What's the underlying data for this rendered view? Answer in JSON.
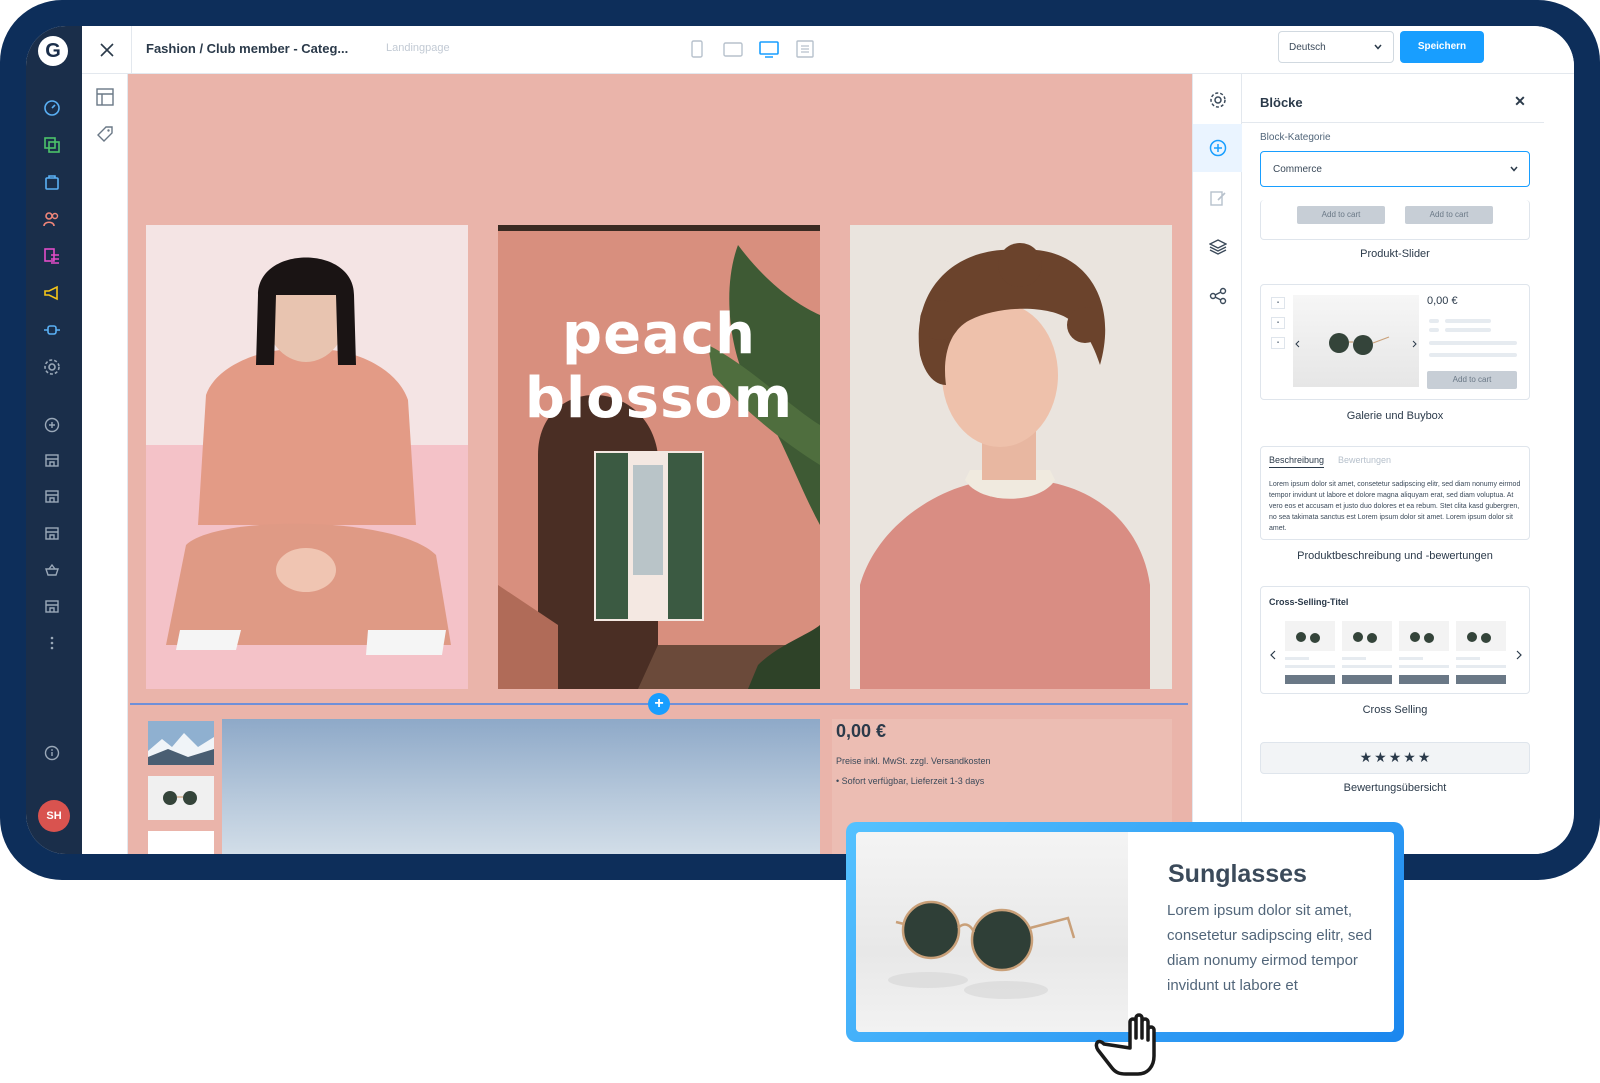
{
  "topbar": {
    "page_title": "Fashion / Club member - Categ...",
    "page_type": "Landingpage",
    "language": "Deutsch",
    "save_label": "Speichern",
    "viewports": [
      "mobile-icon",
      "tablet-icon",
      "desktop-icon",
      "list-view-icon"
    ]
  },
  "nav": {
    "avatar_initials": "SH",
    "items": [
      "dashboard-icon",
      "catalogue-icon",
      "orders-icon",
      "customers-icon",
      "content-icon",
      "marketing-icon",
      "extensions-icon",
      "settings-icon",
      "add-sales-channel-icon",
      "storefront-icon",
      "storefront-icon",
      "storefront-icon",
      "headless-icon",
      "storefront-icon",
      "more-icon",
      "help-icon"
    ]
  },
  "canvas": {
    "headline_line1": "peach",
    "headline_line2": "blossom",
    "price": "0,00 €",
    "tax_note": "Preise inkl. MwSt. zzgl. Versandkosten",
    "availability": "Sofort verfügbar, Lieferzeit 1-3 days",
    "background_color": "#eab4aa"
  },
  "panel": {
    "title": "Blöcke",
    "category_label": "Block-Kategorie",
    "category_value": "Commerce",
    "blocks": {
      "slider": {
        "name": "Produkt-Slider",
        "btn1": "Add to cart",
        "btn2": "Add to cart"
      },
      "gallery": {
        "name": "Galerie und Buybox",
        "price": "0,00 €",
        "btn": "Add to cart"
      },
      "description": {
        "name": "Produktbeschreibung und -bewertungen",
        "tab_active": "Beschreibung",
        "tab_inactive": "Bewertungen",
        "lorem": "Lorem ipsum dolor sit amet, consetetur sadipscing elitr, sed diam nonumy eirmod tempor invidunt ut labore et dolore magna aliquyam erat, sed diam voluptua. At vero eos et accusam et justo duo dolores et ea rebum. Stet clita kasd gubergren, no sea takimata sanctus est Lorem ipsum dolor sit amet. Lorem ipsum dolor sit amet."
      },
      "cross_selling": {
        "name": "Cross Selling",
        "title": "Cross-Selling-Titel"
      },
      "rating": {
        "name": "Bewertungsübersicht",
        "stars": "★★★★★"
      }
    }
  },
  "float_card": {
    "title": "Sunglasses",
    "text": "Lorem ipsum dolor sit amet, consetetur sadipscing elitr, sed diam nonumy eirmod tempor invidunt ut labore et"
  },
  "colors": {
    "accent": "#189eff",
    "frame": "#0d2e5a",
    "nav": "#1a2e4a"
  }
}
